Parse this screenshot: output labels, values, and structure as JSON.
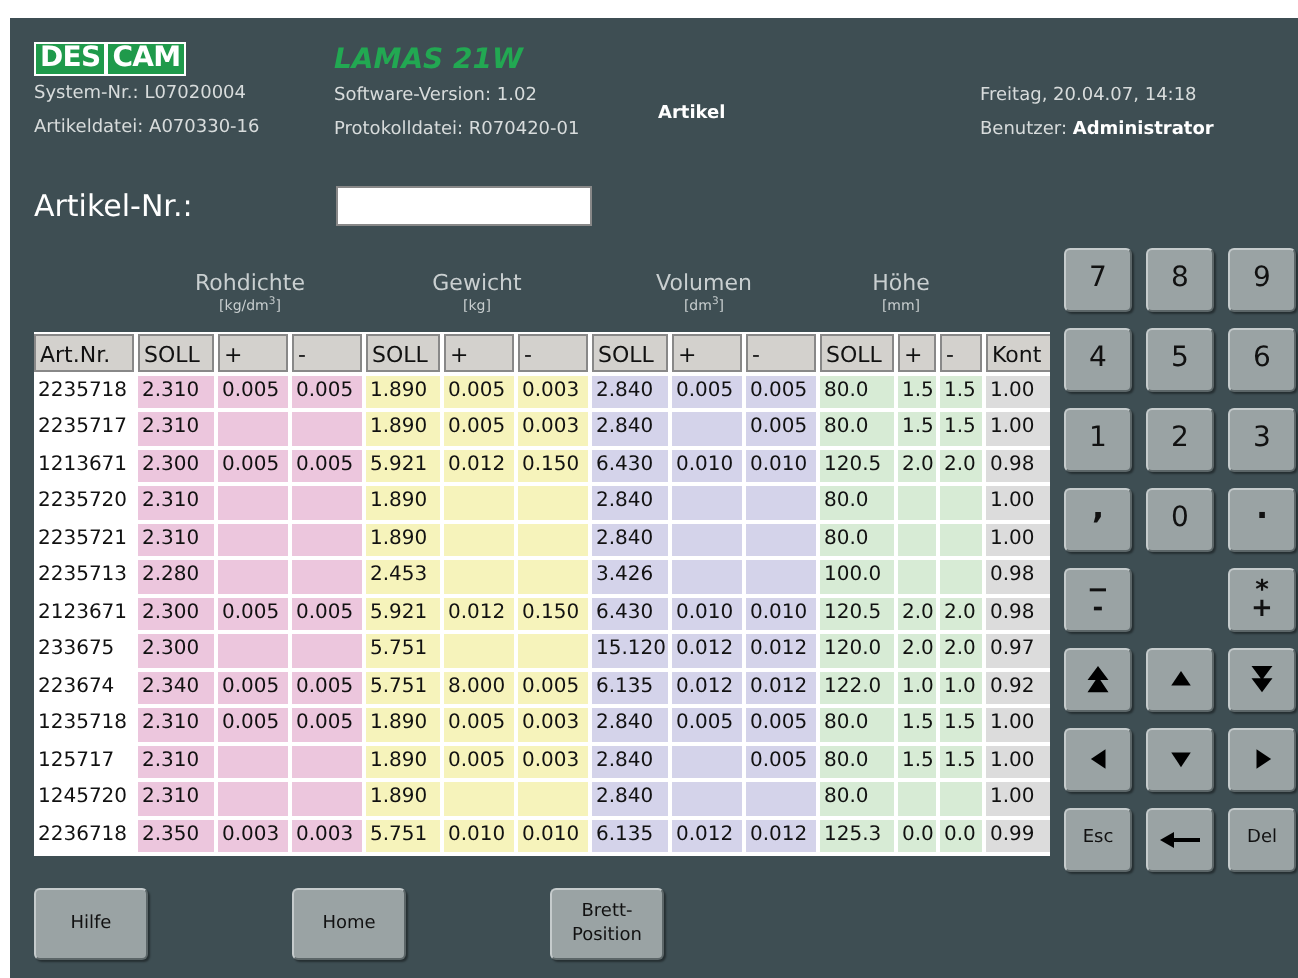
{
  "header": {
    "logo": [
      "DES",
      "CAM"
    ],
    "app_title": "LAMAS 21W",
    "info": [
      {
        "label": "System-Nr.:",
        "value": "L07020004"
      },
      {
        "label": "Artikeldatei:",
        "value": "A070330-16"
      },
      {
        "label": "Software-Version:",
        "value": "1.02"
      },
      {
        "label": "Protokolldatei:",
        "value": "R070420-01"
      }
    ],
    "screen_title": "Artikel",
    "datetime": "Freitag, 20.04.07, 14:18",
    "user_label": "Benutzer:",
    "user": "Administrator"
  },
  "article_field": {
    "label": "Artikel-Nr.:"
  },
  "table": {
    "groups": [
      {
        "columns": [
          {
            "label": "Art.Nr.",
            "color": "#ffffff"
          }
        ]
      },
      {
        "title": "Rohdichte",
        "unit": "[kg/dm$^{3}$]",
        "columns": [
          {
            "label": "SOLL",
            "color": "#ecc6dd"
          },
          {
            "label": "+",
            "color": "#ecc6dd"
          },
          {
            "label": "-",
            "color": "#ecc6dd"
          }
        ]
      },
      {
        "title": "Gewicht",
        "unit": "[kg]",
        "columns": [
          {
            "label": "SOLL",
            "color": "#f6f3bb"
          },
          {
            "label": "+",
            "color": "#f6f3bb"
          },
          {
            "label": "-",
            "color": "#f6f3bb"
          }
        ]
      },
      {
        "title": "Volumen",
        "unit": "[dm$^{3}$]",
        "columns": [
          {
            "label": "SOLL",
            "color": "#d4d3ea"
          },
          {
            "label": "+",
            "color": "#d4d3ea"
          },
          {
            "label": "-",
            "color": "#d4d3ea"
          }
        ]
      },
      {
        "title": "Höhe",
        "unit": "[mm]",
        "columns": [
          {
            "label": "SOLL",
            "color": "#d7ebd5"
          },
          {
            "label": "+",
            "color": "#d7ebd5"
          },
          {
            "label": "-",
            "color": "#d7ebd5"
          }
        ]
      },
      {
        "columns": [
          {
            "label": "Kont",
            "color": "#dcdcdc"
          }
        ]
      }
    ],
    "rows": [
      [
        "2235718",
        "2.310",
        "0.005",
        "0.005",
        "1.890",
        "0.005",
        "0.003",
        "2.840",
        "0.005",
        "0.005",
        "80.0",
        "1.5",
        "1.5",
        "1.00"
      ],
      [
        "2235717",
        "2.310",
        null,
        null,
        "1.890",
        "0.005",
        "0.003",
        "2.840",
        null,
        "0.005",
        "80.0",
        "1.5",
        "1.5",
        "1.00"
      ],
      [
        "1213671",
        "2.300",
        "0.005",
        "0.005",
        "5.921",
        "0.012",
        "0.150",
        "6.430",
        "0.010",
        "0.010",
        "120.5",
        "2.0",
        "2.0",
        "0.98"
      ],
      [
        "2235720",
        "2.310",
        null,
        null,
        "1.890",
        null,
        null,
        "2.840",
        null,
        null,
        "80.0",
        null,
        null,
        "1.00"
      ],
      [
        "2235721",
        "2.310",
        null,
        null,
        "1.890",
        null,
        null,
        "2.840",
        null,
        null,
        "80.0",
        null,
        null,
        "1.00"
      ],
      [
        "2235713",
        "2.280",
        null,
        null,
        "2.453",
        null,
        null,
        "3.426",
        null,
        null,
        "100.0",
        null,
        null,
        "0.98"
      ],
      [
        "2123671",
        "2.300",
        "0.005",
        "0.005",
        "5.921",
        "0.012",
        "0.150",
        "6.430",
        "0.010",
        "0.010",
        "120.5",
        "2.0",
        "2.0",
        "0.98"
      ],
      [
        "233675",
        "2.300",
        null,
        null,
        "5.751",
        null,
        null,
        "15.120",
        "0.012",
        "0.012",
        "120.0",
        "2.0",
        "2.0",
        "0.97"
      ],
      [
        "223674",
        "2.340",
        "0.005",
        "0.005",
        "5.751",
        "8.000",
        "0.005",
        "6.135",
        "0.012",
        "0.012",
        "122.0",
        "1.0",
        "1.0",
        "0.92"
      ],
      [
        "1235718",
        "2.310",
        "0.005",
        "0.005",
        "1.890",
        "0.005",
        "0.003",
        "2.840",
        "0.005",
        "0.005",
        "80.0",
        "1.5",
        "1.5",
        "1.00"
      ],
      [
        "125717",
        "2.310",
        null,
        null,
        "1.890",
        "0.005",
        "0.003",
        "2.840",
        null,
        "0.005",
        "80.0",
        "1.5",
        "1.5",
        "1.00"
      ],
      [
        "1245720",
        "2.310",
        null,
        null,
        "1.890",
        null,
        null,
        "2.840",
        null,
        null,
        "80.0",
        null,
        null,
        "1.00"
      ],
      [
        "2236718",
        "2.350",
        "0.003",
        "0.003",
        "5.751",
        "0.010",
        "0.010",
        "6.135",
        "0.012",
        "0.012",
        "125.3",
        "0.0",
        "0.0",
        "0.99"
      ]
    ]
  },
  "keypad": [
    {
      "kind": "text",
      "label": "7"
    },
    {
      "kind": "text",
      "label": "8"
    },
    {
      "kind": "text",
      "label": "9"
    },
    {
      "kind": "text",
      "label": "4"
    },
    {
      "kind": "text",
      "label": "5"
    },
    {
      "kind": "text",
      "label": "6"
    },
    {
      "kind": "text",
      "label": "1"
    },
    {
      "kind": "text",
      "label": "2"
    },
    {
      "kind": "text",
      "label": "3"
    },
    {
      "kind": "punct",
      "label": ","
    },
    {
      "kind": "text",
      "label": "0"
    },
    {
      "kind": "punct",
      "label": "."
    },
    {
      "kind": "stack",
      "top": "−",
      "bottom": "-"
    },
    {
      "kind": "blank"
    },
    {
      "kind": "stack",
      "top": "*",
      "bottom": "+"
    },
    {
      "kind": "page-up"
    },
    {
      "kind": "up"
    },
    {
      "kind": "page-down"
    },
    {
      "kind": "left"
    },
    {
      "kind": "down"
    },
    {
      "kind": "right"
    },
    {
      "kind": "small",
      "label": "Esc"
    },
    {
      "kind": "back"
    },
    {
      "kind": "small",
      "label": "Del"
    }
  ],
  "buttons": [
    "Hilfe",
    "Home",
    "Brett-Position"
  ]
}
